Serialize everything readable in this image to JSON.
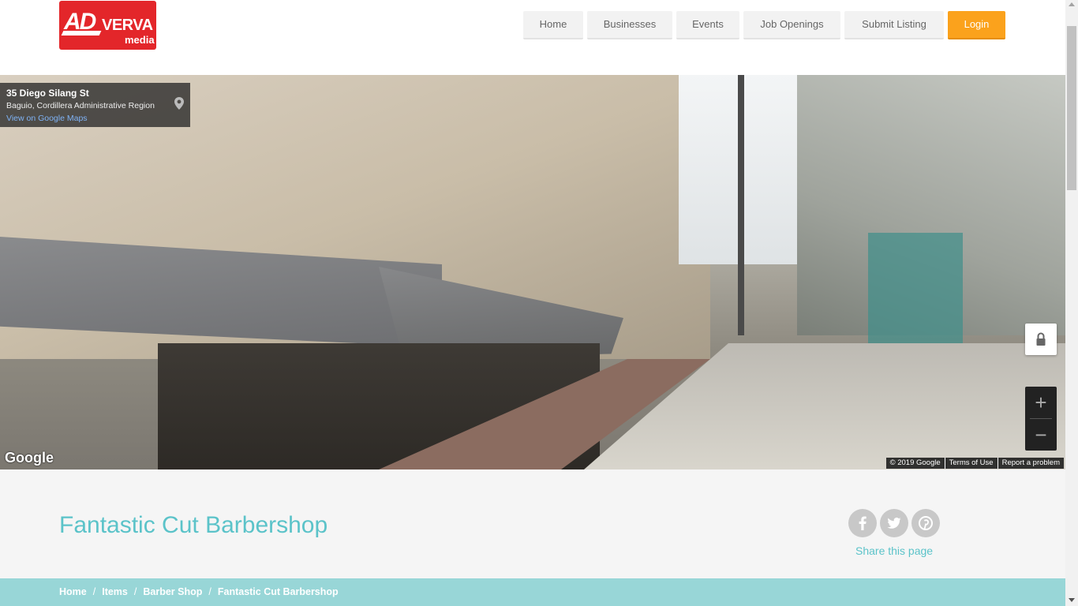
{
  "brand": {
    "logo_ad": "AD",
    "logo_verva": "VERVA",
    "logo_media": "media",
    "color": "#e3262a"
  },
  "nav": {
    "items": [
      {
        "label": "Home"
      },
      {
        "label": "Businesses"
      },
      {
        "label": "Events"
      },
      {
        "label": "Job Openings"
      },
      {
        "label": "Submit Listing"
      }
    ],
    "login": "Login",
    "accent": "#fba21c"
  },
  "streetview": {
    "address_title": "35 Diego Silang St",
    "address_sub": "Baguio, Cordillera Administrative Region",
    "maps_link": "View on Google Maps",
    "google_logo": "Google",
    "footer": [
      "© 2019 Google",
      "Terms of Use",
      "Report a problem"
    ],
    "zoom_in": "+",
    "zoom_out": "−",
    "pin_icon": "map-pin-icon",
    "lock_icon": "lock-icon"
  },
  "listing": {
    "title": "Fantastic Cut Barbershop",
    "share_label": "Share this page",
    "share_icons": [
      "facebook-icon",
      "twitter-icon",
      "pinterest-icon"
    ],
    "title_color": "#5bc3c9"
  },
  "breadcrumb": {
    "items": [
      "Home",
      "Items",
      "Barber Shop",
      "Fantastic Cut Barbershop"
    ],
    "separator": "/",
    "bg": "#98d6d7"
  }
}
